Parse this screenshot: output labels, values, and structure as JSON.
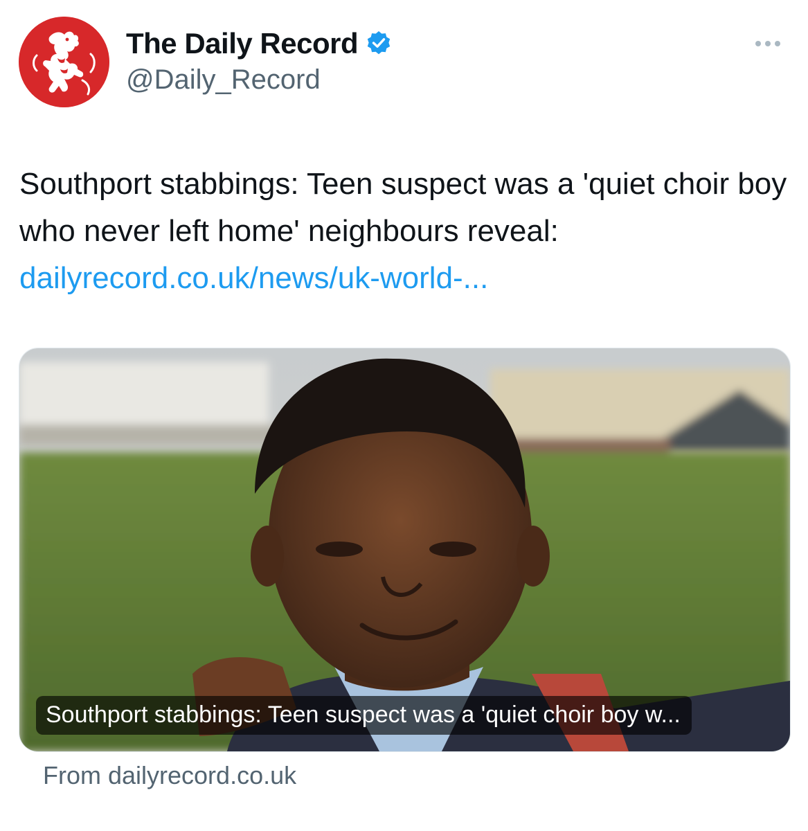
{
  "account": {
    "display_name": "The Daily Record",
    "handle": "@Daily_Record",
    "verified_icon": "verified-badge-icon",
    "avatar_icon": "lion-rampant-icon",
    "brand_color": "#d7282a"
  },
  "menu": {
    "more_icon": "more-horizontal-icon"
  },
  "tweet": {
    "text": "Southport stabbings: Teen suspect was a 'quiet choir boy who never left home' neighbours reveal:",
    "link": "dailyrecord.co.uk/news/uk-world-...",
    "link_color": "#1d9bf0"
  },
  "card": {
    "caption": "Southport stabbings: Teen suspect was a 'quiet choir boy w...",
    "source": "From dailyrecord.co.uk"
  }
}
